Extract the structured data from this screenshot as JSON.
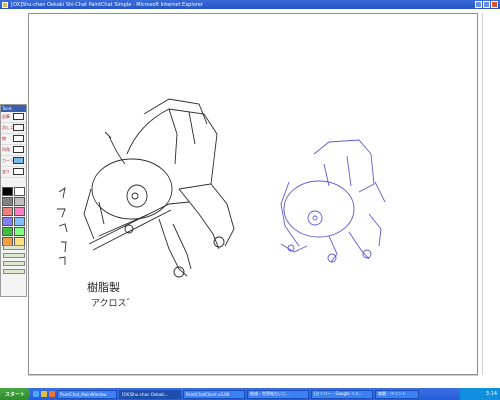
{
  "window": {
    "title": "[OX]Shu-chan Oekaki Shi-Chat PaintChat Simple - Microsoft Internet Explorer"
  },
  "tool_panel": {
    "header": "Tools",
    "tools": [
      {
        "label": "鉛筆",
        "icon": "pencil-icon"
      },
      {
        "label": "消しゴム",
        "icon": "eraser-icon"
      },
      {
        "label": "線",
        "icon": "line-icon"
      },
      {
        "label": "四角",
        "icon": "rectangle-icon"
      },
      {
        "label": "カーソル",
        "icon": "cursor-icon"
      },
      {
        "label": "塗り",
        "icon": "fill-icon"
      }
    ],
    "colors": [
      "#000000",
      "#ffffff",
      "#808080",
      "#c0c0c0",
      "#f08080",
      "#ff80c0",
      "#8080ff",
      "#80c0ff",
      "#40c040",
      "#80ff80",
      "#f0a040",
      "#ffe080"
    ]
  },
  "taskbar": {
    "start_label": "スタート",
    "buttons": [
      {
        "label": "PaintChat_MainWindow",
        "active": false
      },
      {
        "label": "[OX]Shu-chan Oekaki...",
        "active": true
      },
      {
        "label": "PaintChatClient v3.66",
        "active": false
      },
      {
        "label": "絵描・世界絵だいじ...",
        "active": false
      },
      {
        "label": "[セイバー - Google イメ...",
        "active": false
      },
      {
        "label": "無題 - ペイント",
        "active": false
      }
    ],
    "clock": "3:14"
  },
  "canvas": {
    "drawing_left_text_1": "ギクゴゴー",
    "drawing_left_text_2": "樹脂製",
    "drawing_left_text_3": "アクロス゛"
  },
  "colors": {
    "pencil_left": "#2a2a2a",
    "pencil_right": "#5a5ad6"
  }
}
